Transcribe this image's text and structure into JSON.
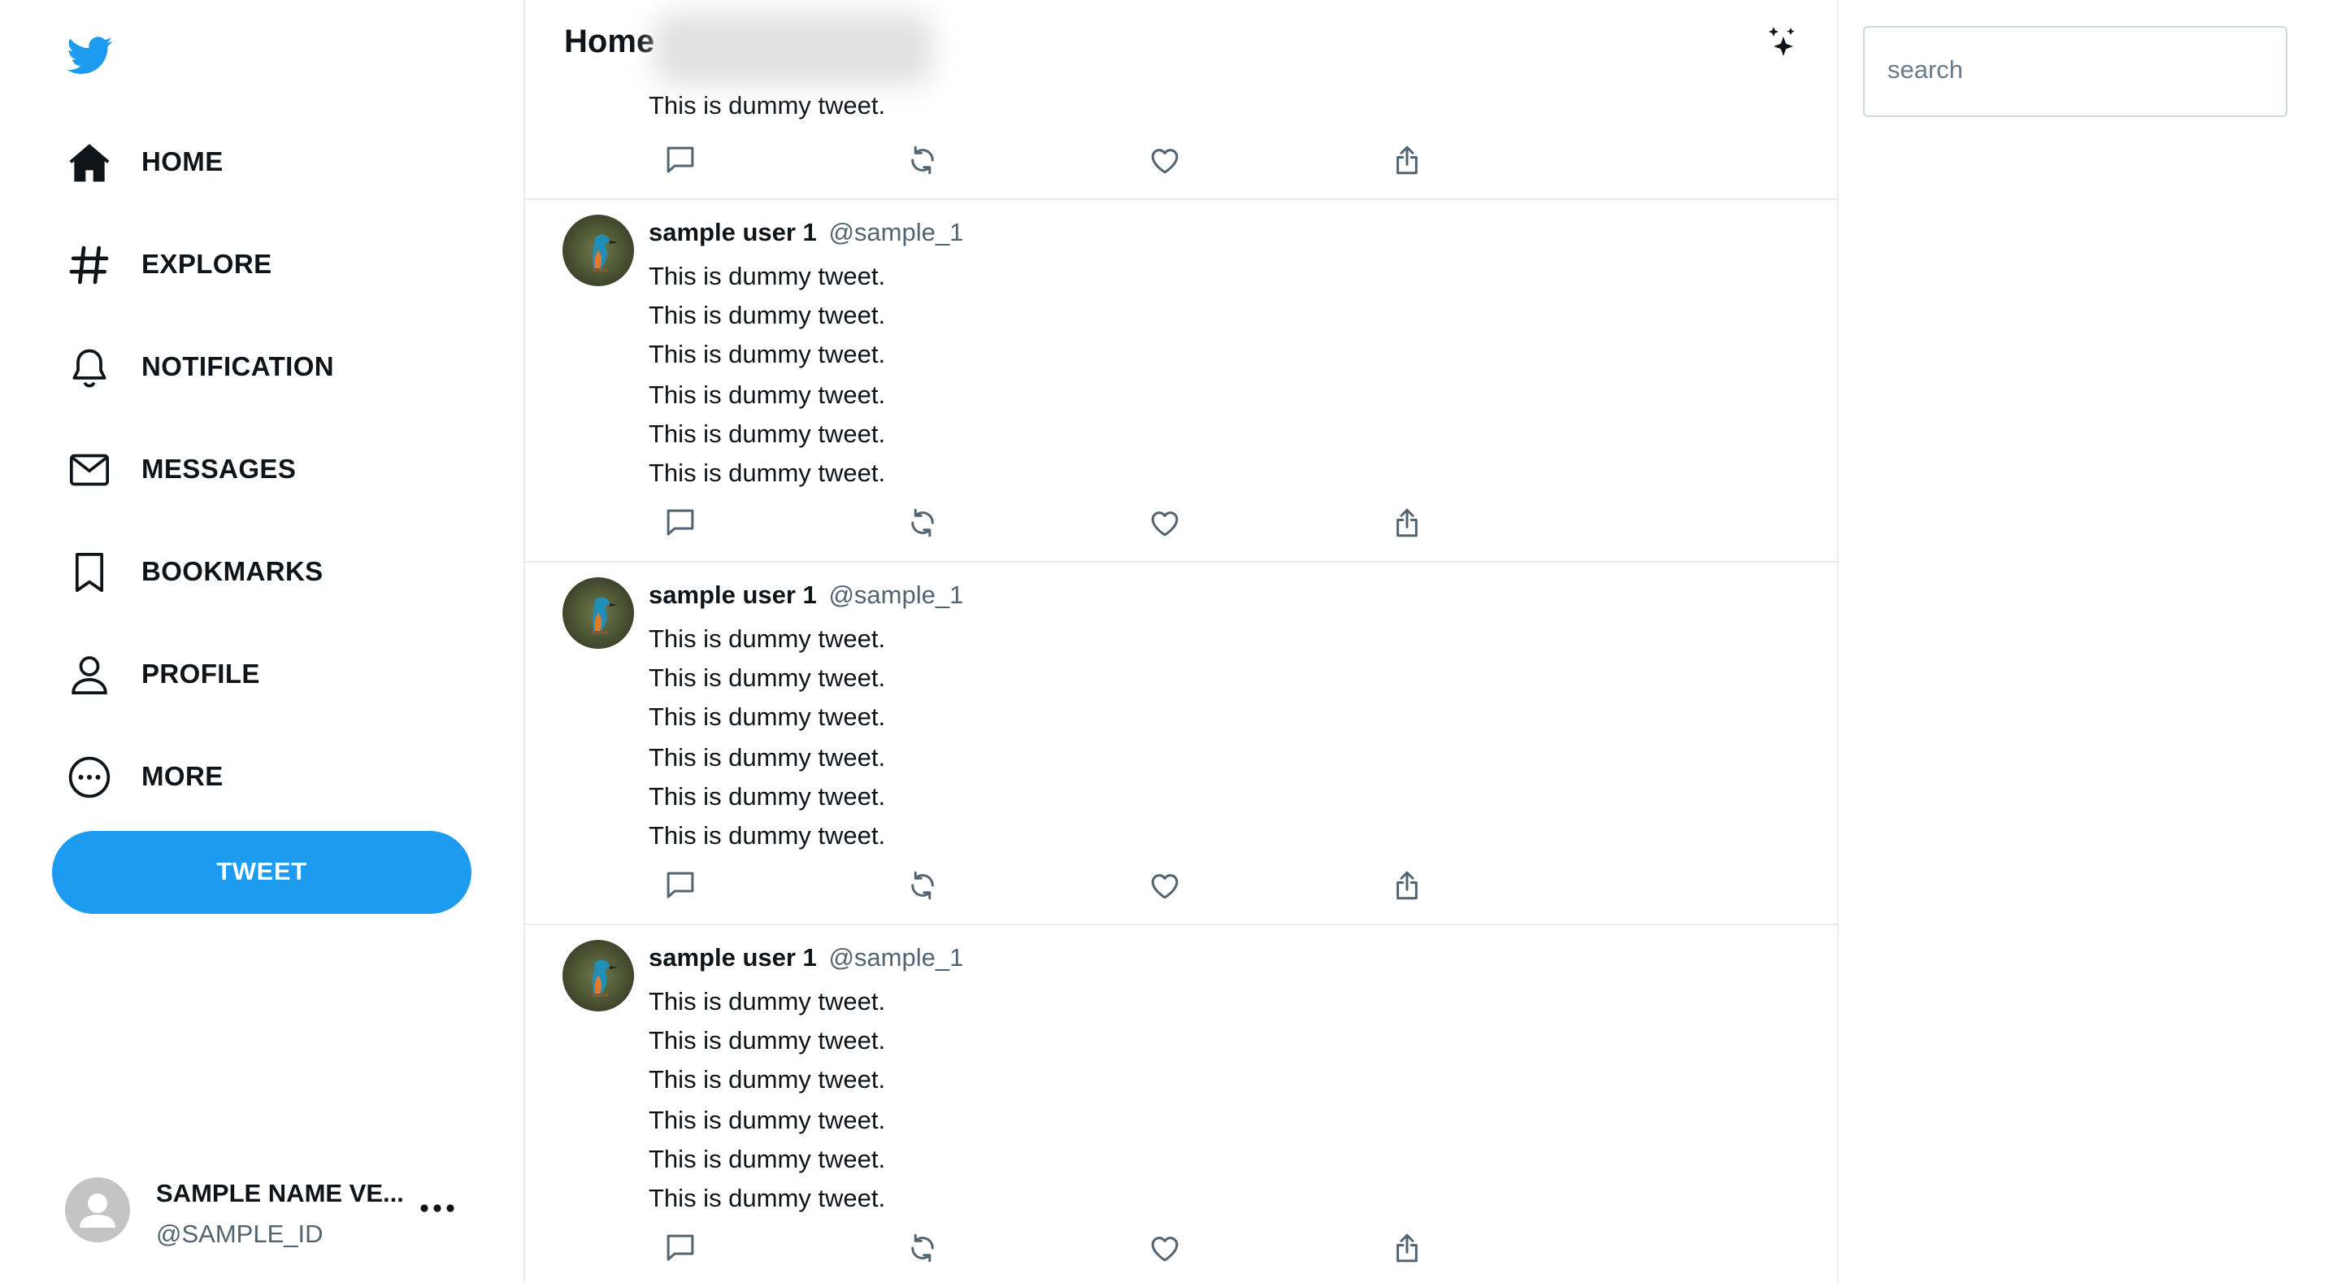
{
  "colors": {
    "brand": "#1d9bf0",
    "text": "#0f1419",
    "muted": "#536471",
    "border": "#e6ecf0"
  },
  "sidebar": {
    "logo_icon": "twitter-bird-icon",
    "nav": [
      {
        "label": "HOME",
        "icon": "home-icon"
      },
      {
        "label": "EXPLORE",
        "icon": "hashtag-icon"
      },
      {
        "label": "NOTIFICATION",
        "icon": "bell-icon"
      },
      {
        "label": "MESSAGES",
        "icon": "mail-icon"
      },
      {
        "label": "BOOKMARKS",
        "icon": "bookmark-icon"
      },
      {
        "label": "PROFILE",
        "icon": "person-icon"
      },
      {
        "label": "MORE",
        "icon": "more-circle-icon"
      }
    ],
    "tweet_button": "TWEET",
    "account": {
      "name": "SAMPLE NAME VE...",
      "handle": "@SAMPLE_ID",
      "more_icon": "more-horizontal-icon"
    }
  },
  "feed": {
    "title": "Home",
    "header_icon": "sparkle-icon",
    "first_partial": {
      "lines": [
        "This is dummy tweet."
      ]
    },
    "tweets": [
      {
        "name": "sample user 1",
        "handle": "@sample_1",
        "lines": [
          "This is dummy tweet.",
          "This is dummy tweet.",
          "This is dummy tweet.",
          "This is dummy tweet.",
          "This is dummy tweet.",
          "This is dummy tweet."
        ]
      },
      {
        "name": "sample user 1",
        "handle": "@sample_1",
        "lines": [
          "This is dummy tweet.",
          "This is dummy tweet.",
          "This is dummy tweet.",
          "This is dummy tweet.",
          "This is dummy tweet.",
          "This is dummy tweet."
        ]
      },
      {
        "name": "sample user 1",
        "handle": "@sample_1",
        "lines": [
          "This is dummy tweet.",
          "This is dummy tweet.",
          "This is dummy tweet.",
          "This is dummy tweet.",
          "This is dummy tweet.",
          "This is dummy tweet."
        ]
      }
    ],
    "action_icons": [
      "reply-icon",
      "retweet-icon",
      "like-icon",
      "share-icon"
    ]
  },
  "search": {
    "placeholder": "search",
    "value": ""
  }
}
